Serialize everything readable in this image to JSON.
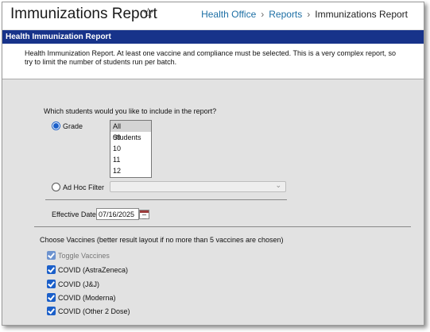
{
  "header": {
    "title": "Immunizations Report",
    "star": "☆",
    "breadcrumbs": [
      "Health Office",
      "Reports",
      "Immunizations Report"
    ],
    "separator": "›"
  },
  "banner": {
    "title": "Health Immunization Report"
  },
  "description": "Health Immunization Report. At least one vaccine and compliance must be selected. This is a very complex report, so try to limit the number of students run per batch.",
  "students": {
    "question": "Which students would you like to include in the report?",
    "grade_label": "Grade",
    "grade_selected": true,
    "grade_options": [
      "All Students",
      "09",
      "10",
      "11",
      "12"
    ],
    "grade_value": "All Students",
    "adhoc_label": "Ad Hoc Filter",
    "adhoc_selected": false,
    "adhoc_value": ""
  },
  "effective_date": {
    "label": "Effective Date:",
    "value": "07/16/2025"
  },
  "vaccines": {
    "heading": "Choose Vaccines (better result layout if no more than 5 vaccines are chosen)",
    "items": [
      {
        "label": "Toggle Vaccines",
        "checked": true
      },
      {
        "label": "COVID (AstraZeneca)",
        "checked": true
      },
      {
        "label": "COVID (J&J)",
        "checked": true
      },
      {
        "label": "COVID (Moderna)",
        "checked": true
      },
      {
        "label": "COVID (Other 2 Dose)",
        "checked": true
      }
    ]
  },
  "colors": {
    "banner": "#17338a",
    "link": "#1d6fa5",
    "checkbox": "#1b5fc9",
    "panel": "#e2e2e2"
  },
  "icons": {
    "star": "star-icon",
    "calendar": "calendar-icon",
    "dropdown": "chevron-down-icon"
  }
}
